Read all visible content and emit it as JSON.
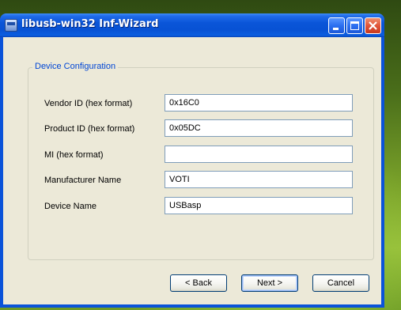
{
  "window": {
    "title": "libusb-win32 Inf-Wizard",
    "icon": "usb-app-icon",
    "title_buttons": {
      "minimize": "minimize-icon",
      "maximize": "maximize-icon",
      "close": "close-icon"
    }
  },
  "group": {
    "legend": "Device Configuration"
  },
  "fields": {
    "vendor_id": {
      "label": "Vendor ID (hex format)",
      "value": "0x16C0"
    },
    "product_id": {
      "label": "Product ID (hex format)",
      "value": "0x05DC"
    },
    "mi": {
      "label": "MI (hex format)",
      "value": ""
    },
    "manufacturer": {
      "label": "Manufacturer Name",
      "value": "VOTI"
    },
    "device_name": {
      "label": "Device Name",
      "value": "USBasp"
    }
  },
  "buttons": {
    "back": "< Back",
    "next": "Next >",
    "cancel": "Cancel"
  },
  "colors": {
    "titlebar": "#0a55d8",
    "client_bg": "#ece9d8",
    "legend_text": "#0046d5",
    "close_button": "#e0553a"
  }
}
